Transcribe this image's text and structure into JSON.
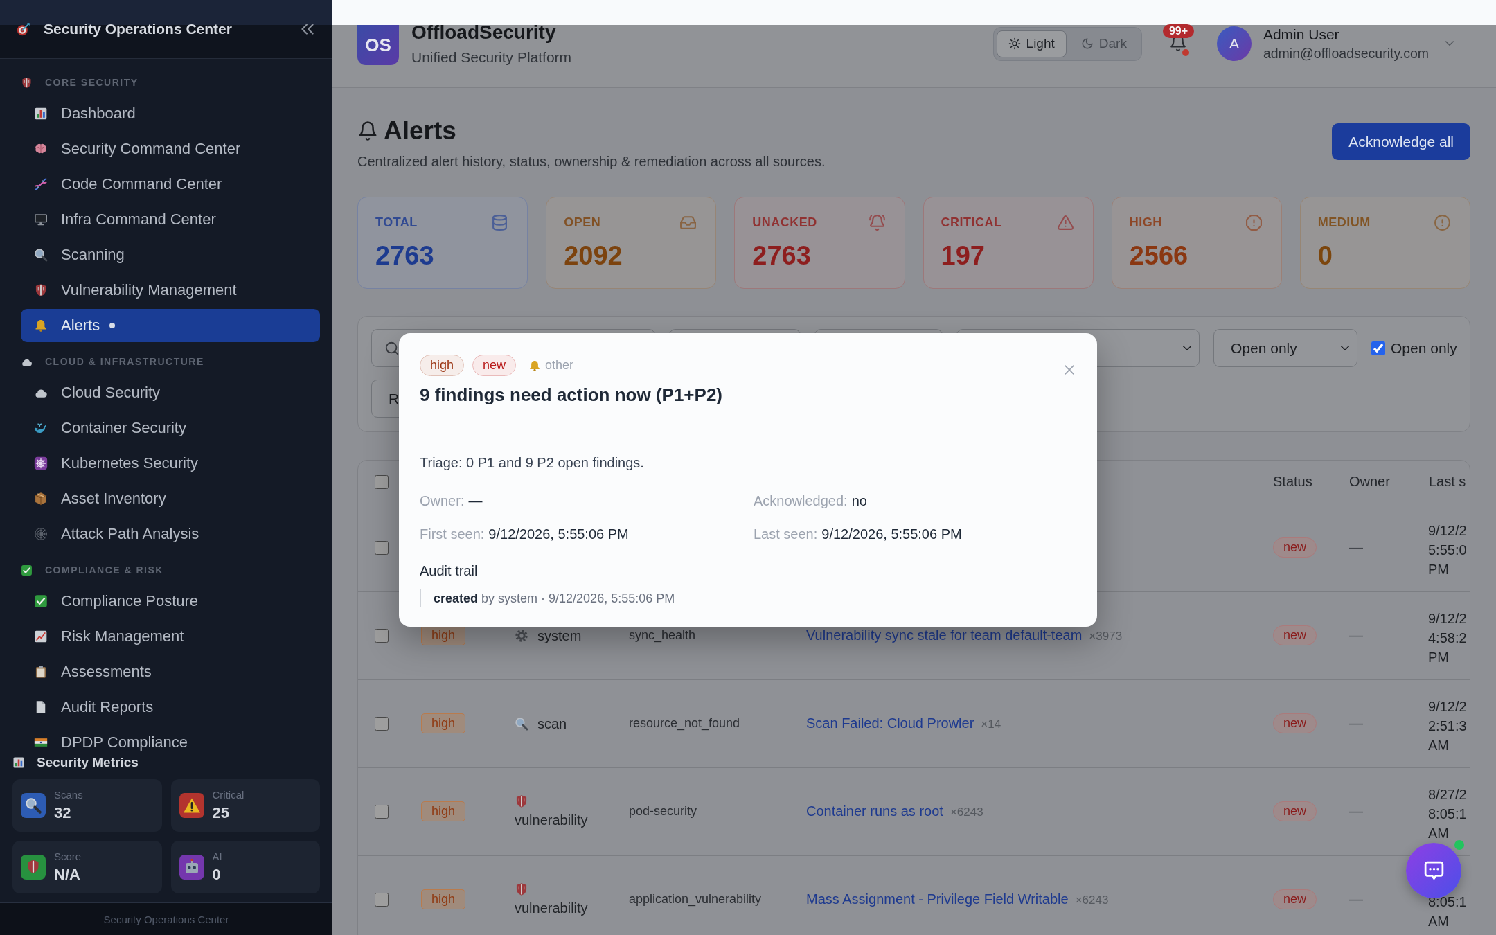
{
  "sidebar": {
    "title": "Security Operations Center",
    "sections": [
      {
        "heading": "CORE SECURITY",
        "items": [
          {
            "label": "Dashboard",
            "selected": false,
            "dot": false
          },
          {
            "label": "Security Command Center",
            "selected": false,
            "dot": false
          },
          {
            "label": "Code Command Center",
            "selected": false,
            "dot": false
          },
          {
            "label": "Infra Command Center",
            "selected": false,
            "dot": false
          },
          {
            "label": "Scanning",
            "selected": false,
            "dot": false
          },
          {
            "label": "Vulnerability Management",
            "selected": false,
            "dot": false
          },
          {
            "label": "Alerts",
            "selected": true,
            "dot": true
          }
        ]
      },
      {
        "heading": "CLOUD & INFRASTRUCTURE",
        "items": [
          {
            "label": "Cloud Security",
            "selected": false,
            "dot": false
          },
          {
            "label": "Container Security",
            "selected": false,
            "dot": false
          },
          {
            "label": "Kubernetes Security",
            "selected": false,
            "dot": false
          },
          {
            "label": "Asset Inventory",
            "selected": false,
            "dot": false
          },
          {
            "label": "Attack Path Analysis",
            "selected": false,
            "dot": false
          }
        ]
      },
      {
        "heading": "COMPLIANCE & RISK",
        "items": [
          {
            "label": "Compliance Posture",
            "selected": false,
            "dot": false
          },
          {
            "label": "Risk Management",
            "selected": false,
            "dot": false
          },
          {
            "label": "Assessments",
            "selected": false,
            "dot": false
          },
          {
            "label": "Audit Reports",
            "selected": false,
            "dot": false
          },
          {
            "label": "DPDP Compliance",
            "selected": false,
            "dot": false
          }
        ]
      }
    ],
    "metrics": {
      "title": "Security Metrics",
      "cards": [
        {
          "label": "Scans",
          "value": "32"
        },
        {
          "label": "Critical",
          "value": "25"
        },
        {
          "label": "Score",
          "value": "N/A"
        },
        {
          "label": "AI",
          "value": "0"
        }
      ]
    },
    "footer": "Security Operations Center"
  },
  "header": {
    "logo": "OS",
    "brand": "OffloadSecurity",
    "tagline": "Unified Security Platform",
    "theme_options": [
      {
        "label": "Light",
        "selected": true
      },
      {
        "label": "Dark",
        "selected": false
      }
    ],
    "notification_badge": "99+",
    "notification_dot": true,
    "user": {
      "avatar": "A",
      "name": "Admin User",
      "email": "admin@offloadsecurity.com"
    }
  },
  "page": {
    "title": "Alerts",
    "subtitle": "Centralized alert history, status, ownership & remediation across all sources.",
    "action": "Acknowledge all"
  },
  "stats": [
    {
      "label": "TOTAL",
      "value": "2763",
      "color": "#1d3b8f"
    },
    {
      "label": "OPEN",
      "value": "2092",
      "color": "#7c430e"
    },
    {
      "label": "UNACKED",
      "value": "2763",
      "color": "#8d1e1e"
    },
    {
      "label": "CRITICAL",
      "value": "197",
      "color": "#8d1e1e"
    },
    {
      "label": "HIGH",
      "value": "2566",
      "color": "#8a3711"
    },
    {
      "label": "MEDIUM",
      "value": "0",
      "color": "#7c460d"
    }
  ],
  "filters": {
    "select_value": "Open only",
    "checkbox": {
      "label": "Open only",
      "checked": true
    },
    "button": "R"
  },
  "table": {
    "header_checked": false,
    "columns": [
      "Status",
      "Owner",
      "Last s"
    ],
    "rows": [
      {
        "checked": false,
        "status": "new",
        "owner": "—",
        "last_seen": "9/12/2 5:55:0 PM"
      },
      {
        "checked": false,
        "column_2": "high",
        "column_3": "system",
        "column_4": "sync_health",
        "column_5": "Vulnerability sync stale for team default-team",
        "column_5_count": "×3973",
        "status": "new",
        "owner": "—",
        "last_seen": "9/12/2 4:58:2 PM"
      },
      {
        "checked": false,
        "column_2": "high",
        "column_3": "scan",
        "column_4": "resource_not_found",
        "column_5": "Scan Failed: Cloud Prowler",
        "column_5_count": "×14",
        "status": "new",
        "owner": "—",
        "last_seen": "9/12/2 2:51:3 AM"
      },
      {
        "checked": false,
        "column_2": "high",
        "column_3": "vulnerability",
        "column_4": "pod-security",
        "column_5": "Container runs as root",
        "column_5_count": "×6243",
        "status": "new",
        "owner": "—",
        "last_seen": "8/27/2 8:05:1 AM"
      },
      {
        "checked": false,
        "column_2": "high",
        "column_3": "vulnerability",
        "column_4": "application_vulnerability",
        "column_5": "Mass Assignment - Privilege Field Writable",
        "column_5_count": "×6243",
        "status": "new",
        "owner": "—",
        "last_seen": "8:05:1 AM"
      }
    ]
  },
  "modal": {
    "tags": [
      {
        "label": "high",
        "color": "#9a3412"
      },
      {
        "label": "new",
        "color": "#b91c1c"
      }
    ],
    "source": "other",
    "title": "9 findings need action now (P1+P2)",
    "description": "Triage: 0 P1 and 9 P2 open findings.",
    "fields": [
      {
        "label": "Owner:",
        "value": "—"
      },
      {
        "label": "Acknowledged:",
        "value": "no"
      },
      {
        "label": "First seen:",
        "value": "9/12/2026, 5:55:06 PM"
      },
      {
        "label": "Last seen:",
        "value": "9/12/2026, 5:55:06 PM"
      }
    ],
    "audit_title": "Audit trail",
    "audit_entries": [
      "**created** by system · 9/12/2026, 5:55:06 PM"
    ]
  },
  "chat_button": {
    "online": true
  }
}
